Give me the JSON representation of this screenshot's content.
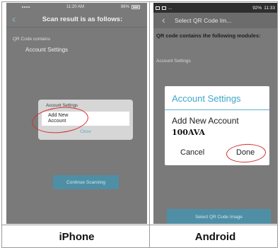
{
  "iphone": {
    "status": {
      "time": "11:20 AM",
      "battery": "86%"
    },
    "nav": {
      "back_icon": "chevron-left-icon",
      "title": "Scan result is as follows:"
    },
    "qr_label": "QR Code contains",
    "qr_value": "Account Settings",
    "dialog": {
      "title": "Account Settings",
      "option": "Add New Account",
      "close": "Close"
    },
    "continue_button": "Continue Scanning",
    "caption": "iPhone"
  },
  "android": {
    "status": {
      "right": "92%",
      "time": "11:33"
    },
    "nav": {
      "back_icon": "chevron-left-icon",
      "title": "Select QR Code Im..."
    },
    "qr_label": "QR code contains the following modules:",
    "qr_value": "Account Settings",
    "dialog": {
      "title": "Account Settings",
      "option": "Add New Account",
      "value": "100AVA",
      "cancel": "Cancel",
      "done": "Done"
    },
    "select_button": "Select QR Code Image",
    "caption": "Android"
  },
  "colors": {
    "highlight": "#d43030",
    "accent": "#3fa7c9",
    "button": "#4f8fa6"
  }
}
